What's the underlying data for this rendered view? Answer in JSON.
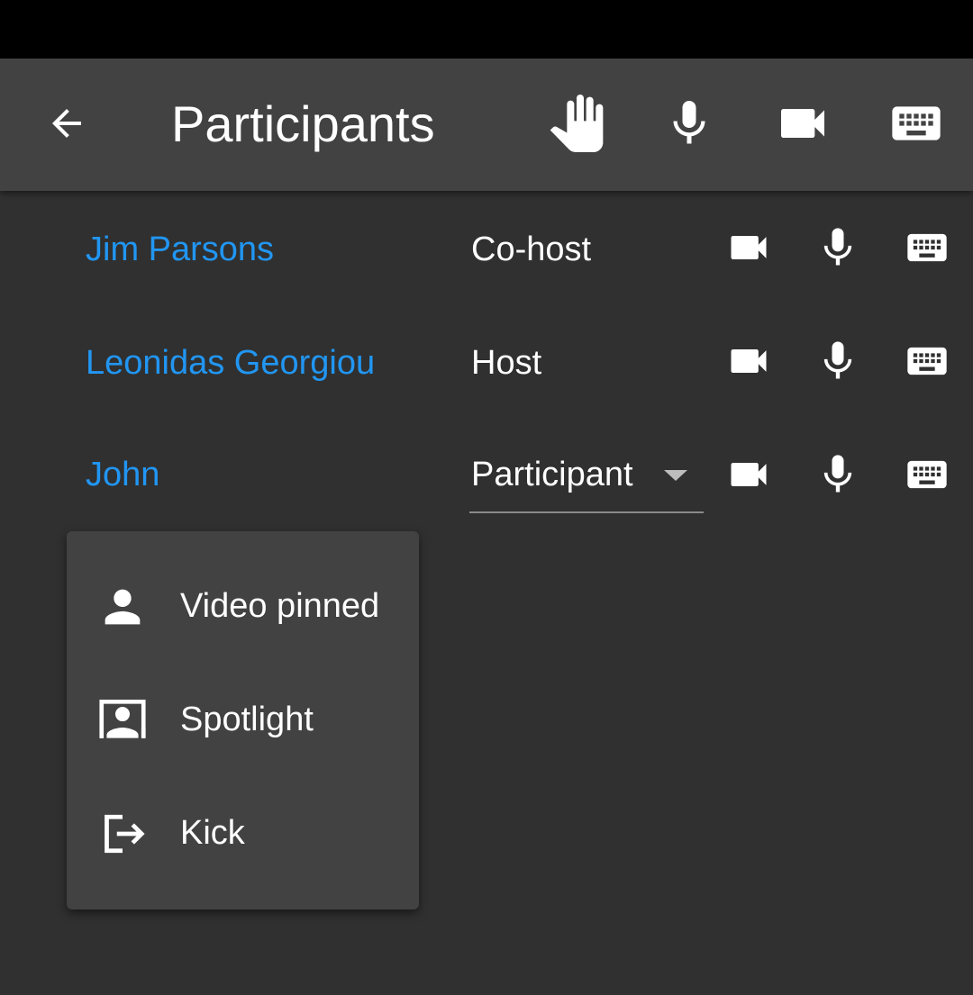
{
  "header": {
    "title": "Participants",
    "icons": [
      "back-arrow-icon",
      "raise-hand-icon",
      "microphone-icon",
      "video-camera-icon",
      "keyboard-icon"
    ]
  },
  "participants": [
    {
      "name": "Jim Parsons",
      "role": "Co-host"
    },
    {
      "name": "Leonidas Georgiou",
      "role": "Host"
    },
    {
      "name": "John",
      "role": "Participant"
    }
  ],
  "menu": {
    "items": [
      {
        "label": "Video pinned",
        "icon": "person-icon"
      },
      {
        "label": "Spotlight",
        "icon": "spotlight-icon"
      },
      {
        "label": "Kick",
        "icon": "exit-icon"
      }
    ]
  },
  "colors": {
    "background": "#303030",
    "app_bar": "#424242",
    "menu": "#424242",
    "name_accent": "#2196f3",
    "text": "#ffffff"
  }
}
